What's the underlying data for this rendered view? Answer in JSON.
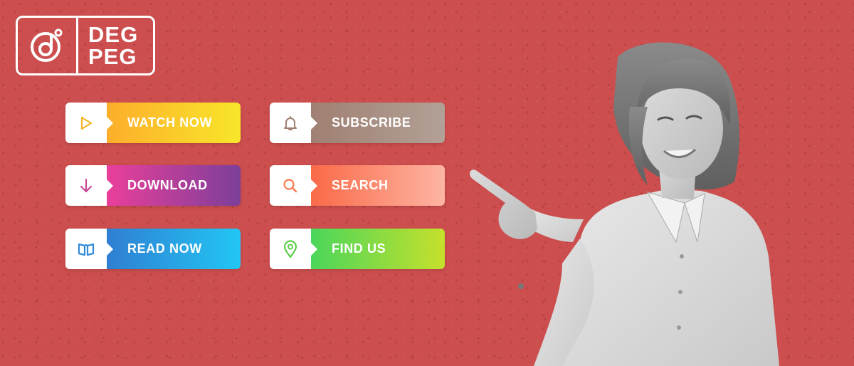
{
  "colors": {
    "background": "#cc4e4e",
    "logo": "#ffffff"
  },
  "logo": {
    "line1": "DEG",
    "line2": "PEG",
    "mark": "dp-power-mark-icon"
  },
  "buttons": [
    {
      "label": "WATCH NOW",
      "icon": "play-icon",
      "icon_color": "#f5b52a"
    },
    {
      "label": "DOWNLOAD",
      "icon": "download-arrow-icon",
      "icon_color": "#c84a9a"
    },
    {
      "label": "READ NOW",
      "icon": "book-icon",
      "icon_color": "#2f8ad8"
    },
    {
      "label": "SUBSCRIBE",
      "icon": "bell-icon",
      "icon_color": "#a08072"
    },
    {
      "label": "SEARCH",
      "icon": "search-icon",
      "icon_color": "#fa7a50"
    },
    {
      "label": "FIND US",
      "icon": "map-pin-icon",
      "icon_color": "#5ccf4a"
    }
  ]
}
